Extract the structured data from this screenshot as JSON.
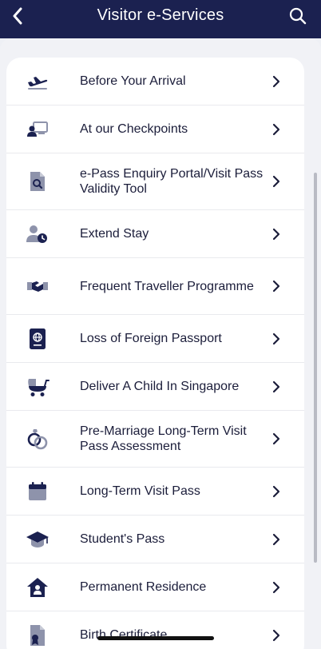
{
  "header": {
    "title": "Visitor e-Services",
    "back_icon": "chevron-left-icon",
    "search_icon": "search-icon"
  },
  "colors": {
    "header_bg": "#1b2150",
    "icon_dark": "#1b2150",
    "icon_light": "#8e93ab"
  },
  "items": [
    {
      "label": "Before Your Arrival",
      "icon": "airplane-departure-icon"
    },
    {
      "label": "At our Checkpoints",
      "icon": "checkpoint-officer-icon"
    },
    {
      "label": "e-Pass Enquiry Portal/Visit Pass Validity Tool",
      "icon": "document-search-icon"
    },
    {
      "label": "Extend Stay",
      "icon": "person-clock-icon"
    },
    {
      "label": "Frequent Traveller Programme",
      "icon": "handshake-icon"
    },
    {
      "label": "Loss of Foreign Passport",
      "icon": "passport-icon"
    },
    {
      "label": "Deliver A Child In Singapore",
      "icon": "baby-stroller-icon"
    },
    {
      "label": "Pre-Marriage Long-Term Visit Pass Assessment",
      "icon": "rings-icon"
    },
    {
      "label": "Long-Term Visit Pass",
      "icon": "calendar-icon"
    },
    {
      "label": "Student's Pass",
      "icon": "graduation-cap-icon"
    },
    {
      "label": "Permanent Residence",
      "icon": "home-person-icon"
    },
    {
      "label": "Birth Certificate",
      "icon": "certificate-icon"
    }
  ]
}
